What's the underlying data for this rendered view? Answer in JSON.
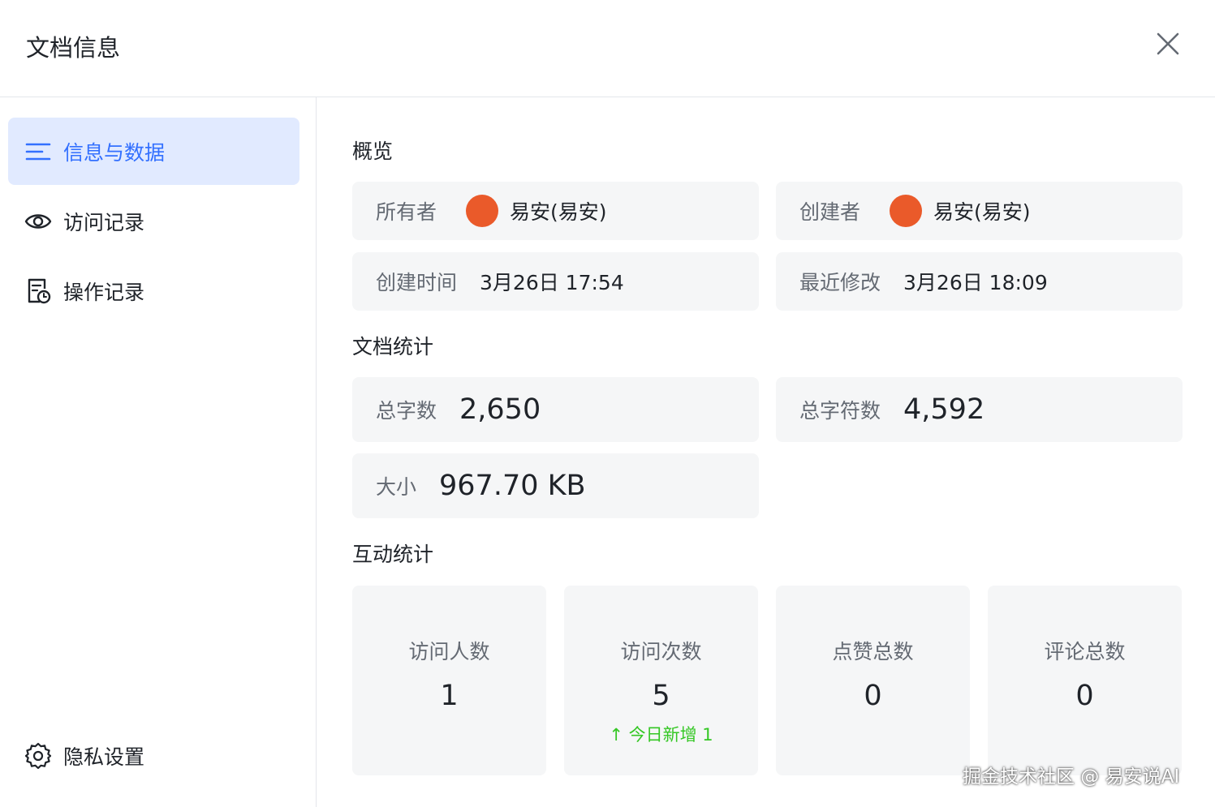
{
  "dialog": {
    "title": "文档信息",
    "close_icon": "close-icon"
  },
  "sidebar": {
    "items": [
      {
        "label": "信息与数据",
        "icon": "list-icon",
        "active": true
      },
      {
        "label": "访问记录",
        "icon": "eye-icon",
        "active": false
      },
      {
        "label": "操作记录",
        "icon": "document-clock-icon",
        "active": false
      }
    ],
    "privacy": {
      "label": "隐私设置",
      "icon": "gear-icon"
    }
  },
  "overview": {
    "title": "概览",
    "owner_label": "所有者",
    "owner_name": "易安(易安)",
    "creator_label": "创建者",
    "creator_name": "易安(易安)",
    "created_label": "创建时间",
    "created_value": "3月26日 17:54",
    "modified_label": "最近修改",
    "modified_value": "3月26日 18:09",
    "avatar_color": "#ea5a2a"
  },
  "doc_stats": {
    "title": "文档统计",
    "words_label": "总字数",
    "words_value": "2,650",
    "chars_label": "总字符数",
    "chars_value": "4,592",
    "size_label": "大小",
    "size_value": "967.70 KB"
  },
  "interaction": {
    "title": "互动统计",
    "stats": [
      {
        "label": "访问人数",
        "value": "1",
        "today": ""
      },
      {
        "label": "访问次数",
        "value": "5",
        "today": "今日新增 1"
      },
      {
        "label": "点赞总数",
        "value": "0",
        "today": ""
      },
      {
        "label": "评论总数",
        "value": "0",
        "today": ""
      }
    ]
  },
  "watermark": "掘金技术社区 @ 易安说AI",
  "colors": {
    "accent": "#3370ff",
    "active_bg": "#e1eaff",
    "card_bg": "#f5f6f7",
    "increase": "#34c724"
  }
}
